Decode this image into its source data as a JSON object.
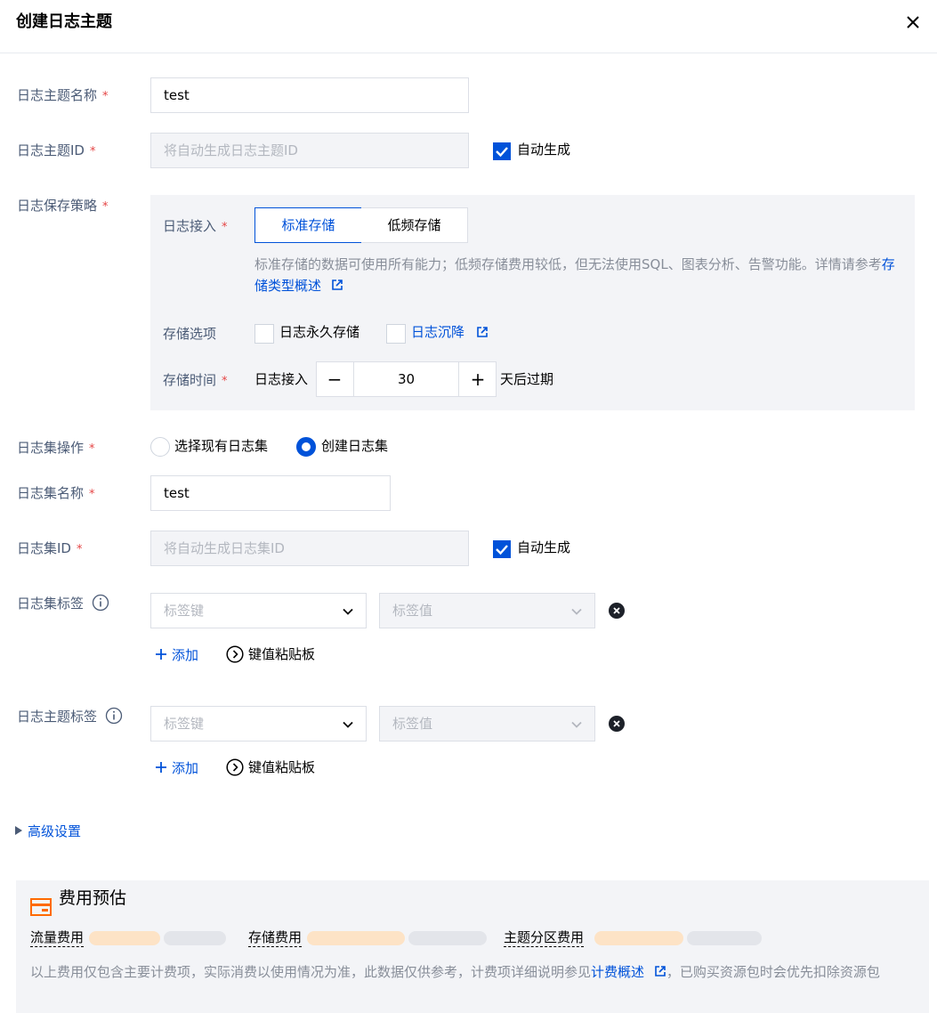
{
  "dialog": {
    "title": "创建日志主题",
    "close_icon": "close-icon"
  },
  "form": {
    "topic_name": {
      "label": "日志主题名称",
      "value": "test"
    },
    "topic_id": {
      "label": "日志主题ID",
      "placeholder": "将自动生成日志主题ID",
      "auto_label": "自动生成",
      "auto_checked": true
    },
    "retention": {
      "label": "日志保存策略",
      "ingest_label": "日志接入",
      "tiers": [
        "标准存储",
        "低频存储"
      ],
      "selected_tier": "标准存储",
      "desc_before": "标准存储的数据可使用所有能力；低频存储费用较低，但无法使用SQL、图表分析、告警功能。详情请参考",
      "desc_link": "存储类型概述",
      "options_label": "存储选项",
      "opt_permanent": "日志永久存储",
      "opt_sink": "日志沉降",
      "time_label": "存储时间",
      "time_prefix": "日志接入",
      "days": "30",
      "time_suffix": "天后过期",
      "minus": "−",
      "plus": "+"
    },
    "logset_op": {
      "label": "日志集操作",
      "options": [
        "选择现有日志集",
        "创建日志集"
      ],
      "selected": "创建日志集"
    },
    "logset_name": {
      "label": "日志集名称",
      "value": "test"
    },
    "logset_id": {
      "label": "日志集ID",
      "placeholder": "将自动生成日志集ID",
      "auto_label": "自动生成",
      "auto_checked": true
    },
    "logset_tags": {
      "label": "日志集标签",
      "key_placeholder": "标签键",
      "value_placeholder": "标签值",
      "add": "添加",
      "paste": "键值粘贴板"
    },
    "topic_tags": {
      "label": "日志主题标签",
      "key_placeholder": "标签键",
      "value_placeholder": "标签值",
      "add": "添加",
      "paste": "键值粘贴板"
    },
    "required_mark": "*",
    "advanced": "高级设置"
  },
  "cost": {
    "title": "费用预估",
    "items": [
      "流量费用",
      "存储费用",
      "主题分区费用"
    ],
    "note_before": "以上费用仅包含主要计费项，实际消费以使用情况为准，此数据仅供参考，计费项详细说明参见",
    "note_link": "计费概述",
    "note_after": "，已购买资源包时会优先扣除资源包"
  },
  "colors": {
    "accent": "#0052d9",
    "required": "#e54545",
    "label": "#4b5b76",
    "muted": "#888e99",
    "panel": "#f3f4f7"
  }
}
